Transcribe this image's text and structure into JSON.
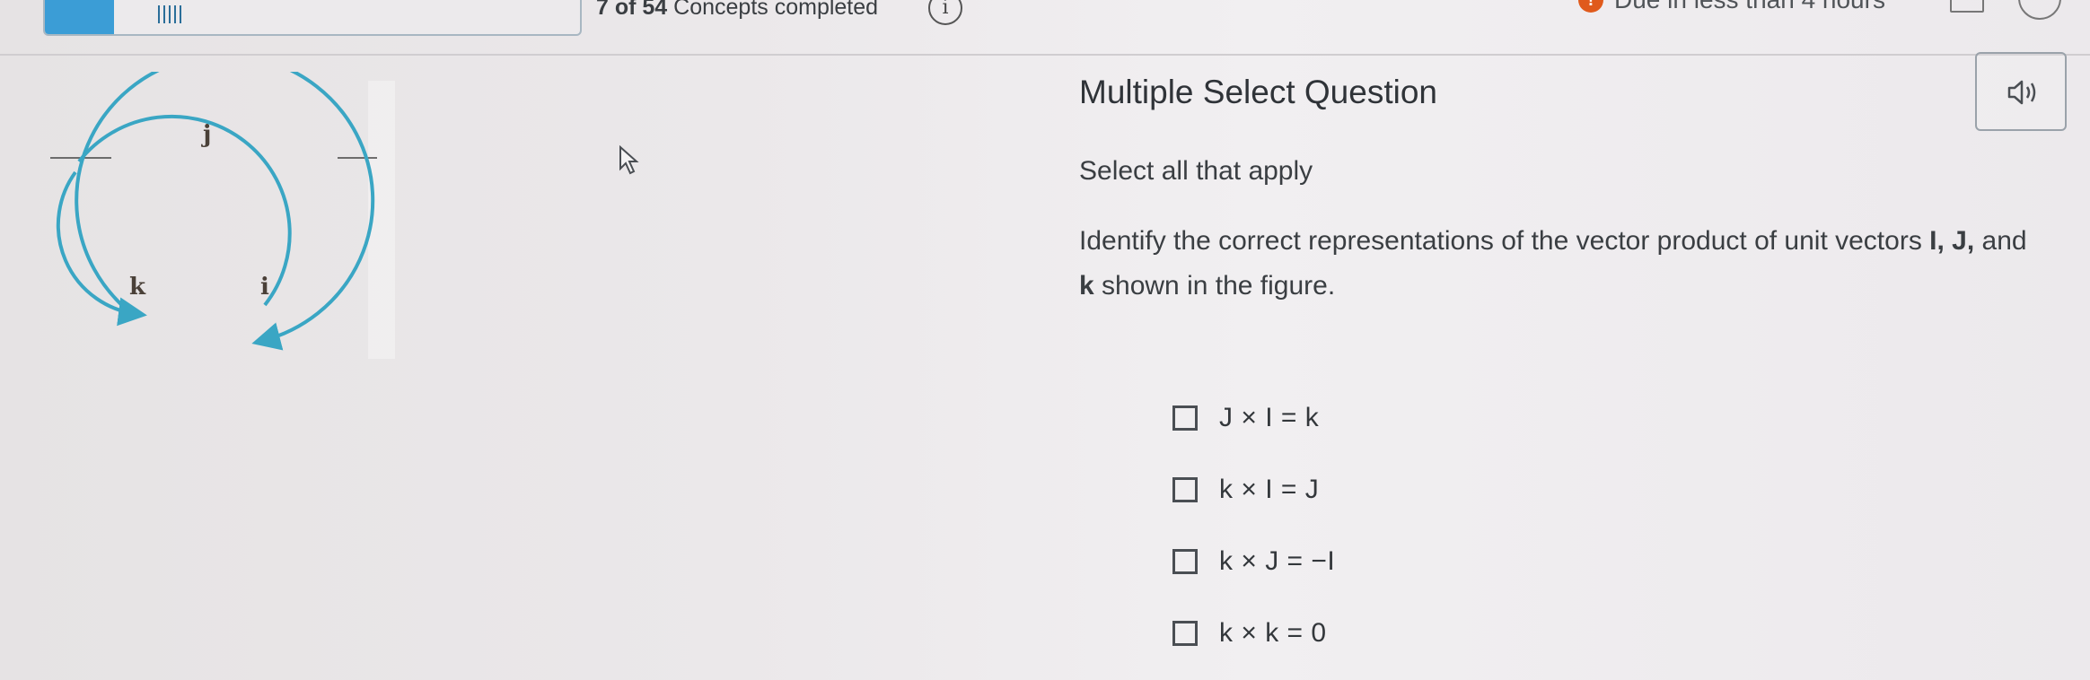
{
  "header": {
    "progress_count": "7 of 54",
    "progress_label": "Concepts completed",
    "progress_fraction": 0.13,
    "due_text": "Due in less than 4 hours"
  },
  "figure": {
    "labels": {
      "j": "j",
      "k": "k",
      "i": "i"
    },
    "arrow_color": "#3aa6c4"
  },
  "question": {
    "type_title": "Multiple Select Question",
    "instruction": "Select all that apply",
    "prompt_part1": "Identify the correct representations of the vector product of unit vectors ",
    "prompt_vectors": "I, J,",
    "prompt_part2": " and ",
    "prompt_k": "k",
    "prompt_part3": " shown in the figure."
  },
  "options": [
    {
      "label": "J × I = k",
      "checked": false
    },
    {
      "label": "k × I = J",
      "checked": false
    },
    {
      "label": "k × J = −I",
      "checked": false
    },
    {
      "label": "k × k = 0",
      "checked": false
    }
  ]
}
